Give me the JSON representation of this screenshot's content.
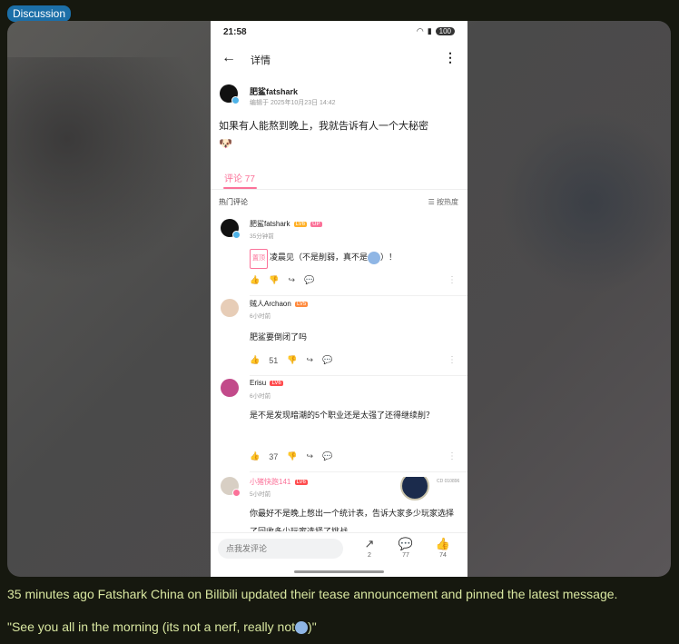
{
  "post_tag": "Discussion",
  "phone": {
    "status_time": "21:58",
    "battery": "100",
    "header_title": "详情",
    "post": {
      "author": "肥鲨fatshark",
      "edited": "编辑于 2025年10月23日 14:42",
      "text": "如果有人能熬到晚上，我就告诉有人一个大秘密"
    },
    "tab_comments": "评论 77",
    "hot_comments_label": "热门评论",
    "sort_label": "按热度",
    "comments": [
      {
        "name": "肥鲨fatshark",
        "level": "LV6",
        "badge": "UP",
        "time": "35分钟前",
        "pinned": "置顶",
        "text": "凌晨见（不是削弱，真不是",
        "text_end": "）！",
        "likes": ""
      },
      {
        "name": "贼人Archaon",
        "level": "LV5",
        "time": "6小时前",
        "text": "肥鲨要倒闭了吗",
        "likes": "51"
      },
      {
        "name": "Erisu",
        "level": "LV6",
        "time": "6小时前",
        "text": "是不是发现暗潮的5个职业还是太强了还得继续削？",
        "likes": "37"
      },
      {
        "name": "小猪快跑141",
        "level": "LV6",
        "time": "5小时前",
        "text": "你最好不是晚上憋出一个统计表，告诉大家多少玩家选择了回收多少玩家选择了挑战",
        "likes": "",
        "fan_label": "CD 010896"
      }
    ],
    "reply_placeholder": "点我发评论",
    "bottom_counts": {
      "share": "2",
      "comment": "77",
      "like": "74"
    },
    "colors": {
      "accent": "#fb7299"
    }
  },
  "caption_1": "35 minutes ago Fatshark China on Bilibili updated their tease announcement and pinned the latest message.",
  "caption_2_start": "\"See you all in the morning (its not a nerf, really not",
  "caption_2_end": ")\""
}
